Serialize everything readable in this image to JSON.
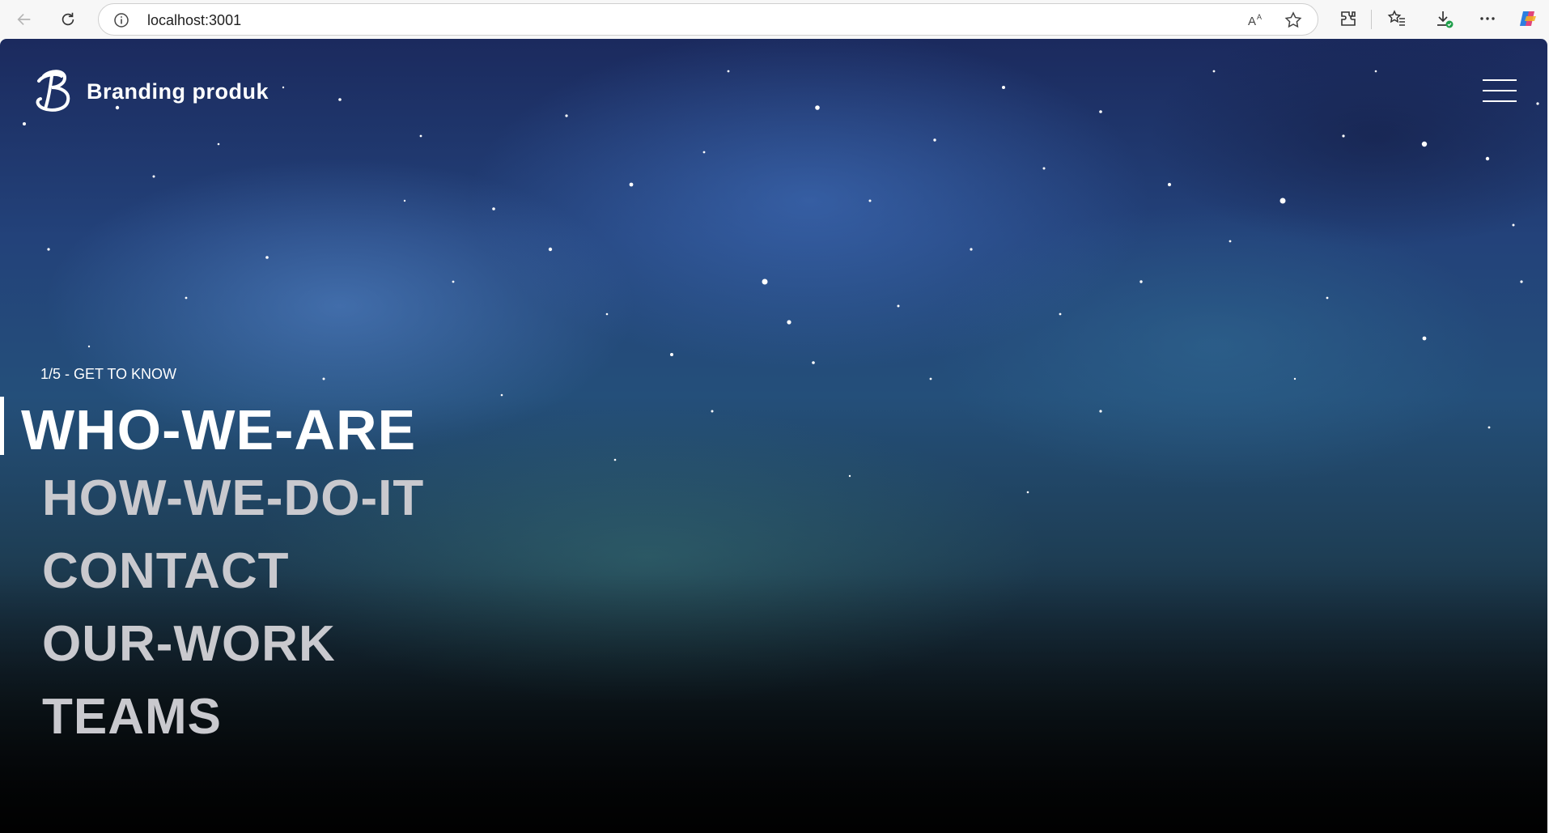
{
  "browser": {
    "url": "localhost:3001",
    "icons": [
      "back-icon",
      "refresh-icon",
      "info-icon",
      "read-aloud-icon",
      "favorite-star-icon",
      "extensions-icon",
      "favorites-icon",
      "downloads-icon",
      "more-icon",
      "copilot-icon"
    ]
  },
  "site": {
    "brand": "Branding produk",
    "step_label": "1/5 - GET TO KNOW",
    "menu": [
      {
        "label": "WHO-WE-ARE",
        "active": true
      },
      {
        "label": "HOW-WE-DO-IT",
        "active": false
      },
      {
        "label": "CONTACT",
        "active": false
      },
      {
        "label": "OUR-WORK",
        "active": false
      },
      {
        "label": "TEAMS",
        "active": false
      }
    ]
  },
  "colors": {
    "active_text": "#ffffff",
    "inactive_text": "#c9c9ce",
    "background_top": "#1b2a5e",
    "background_bottom": "#050607"
  }
}
